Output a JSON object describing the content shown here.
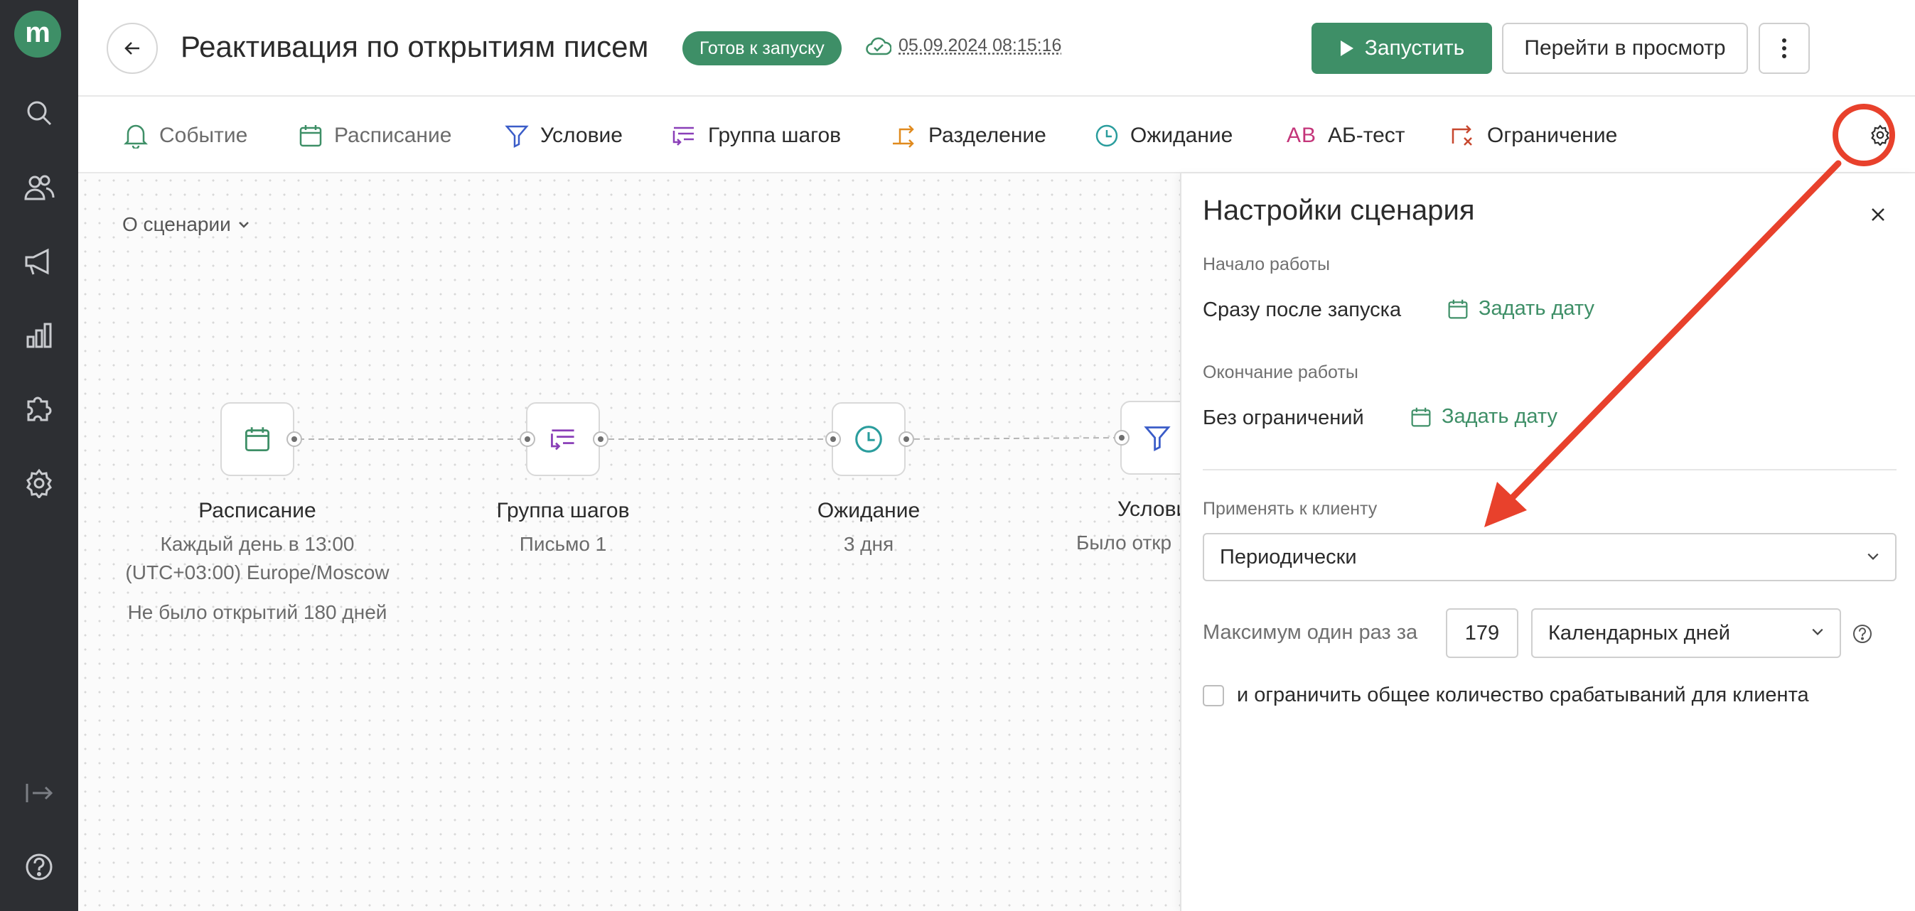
{
  "app": {
    "logo_letter": "m",
    "accent_color": "#3e8f67"
  },
  "sidebar": {
    "items": [
      {
        "icon": "search-icon"
      },
      {
        "icon": "users-icon"
      },
      {
        "icon": "megaphone-icon"
      },
      {
        "icon": "bar-chart-icon"
      },
      {
        "icon": "puzzle-icon"
      },
      {
        "icon": "gear-icon"
      },
      {
        "icon": "collapse-icon"
      },
      {
        "icon": "help-icon"
      }
    ]
  },
  "header": {
    "title": "Реактивация по открытиям писем",
    "status": "Готов к запуску",
    "saved_at": "05.09.2024 08:15:16",
    "run_label": "Запустить",
    "preview_label": "Перейти в просмотр"
  },
  "toolbar": {
    "items": [
      {
        "label": "Событие",
        "icon": "bell-icon"
      },
      {
        "label": "Расписание",
        "icon": "calendar-icon"
      },
      {
        "label": "Условие",
        "icon": "filter-icon"
      },
      {
        "label": "Группа шагов",
        "icon": "step-group-icon"
      },
      {
        "label": "Разделение",
        "icon": "split-icon"
      },
      {
        "label": "Ожидание",
        "icon": "clock-icon"
      },
      {
        "label": "АБ-тест",
        "icon": "ab-test-icon"
      },
      {
        "label": "Ограничение",
        "icon": "limit-icon"
      }
    ],
    "ab_glyph": "AB"
  },
  "canvas": {
    "about_label": "О сценарии",
    "nodes": [
      {
        "title": "Расписание",
        "lines": [
          "Каждый день в 13:00",
          "(UTC+03:00) Europe/Moscow"
        ],
        "extra": "Не было открытий 180 дней",
        "icon": "calendar-icon"
      },
      {
        "title": "Группа шагов",
        "lines": [
          "Письмо 1"
        ],
        "icon": "step-group-icon"
      },
      {
        "title": "Ожидание",
        "lines": [
          "3 дня"
        ],
        "icon": "clock-icon"
      },
      {
        "title": "Услови",
        "lines": [
          "Было откр"
        ],
        "icon": "filter-icon"
      }
    ]
  },
  "panel": {
    "title": "Настройки сценария",
    "start": {
      "label": "Начало работы",
      "value": "Сразу после запуска",
      "action": "Задать дату"
    },
    "end": {
      "label": "Окончание работы",
      "value": "Без ограничений",
      "action": "Задать дату"
    },
    "apply": {
      "label": "Применять к клиенту",
      "value": "Периодически"
    },
    "max": {
      "label": "Максимум один раз за",
      "number": "179",
      "unit": "Календарных дней"
    },
    "limit_checkbox_label": "и ограничить общее количество срабатываний для клиента",
    "limit_checked": false
  },
  "annotation": {
    "color": "#e8412c"
  }
}
